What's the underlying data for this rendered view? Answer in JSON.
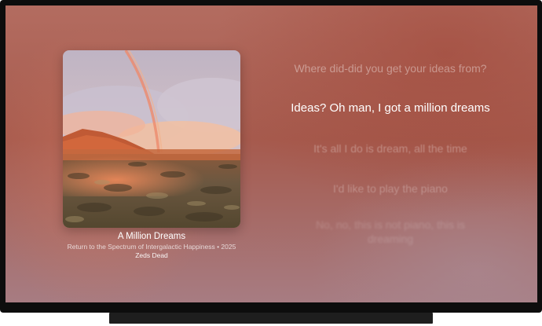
{
  "track": {
    "title": "A Million Dreams",
    "album_line": "Return to the Spectrum of Intergalactic Happiness • 2025",
    "artist": "Zeds Dead"
  },
  "lyrics": [
    "Where did-did you get your ideas from?",
    "Ideas? Oh man, I got a million dreams",
    "It's all I do is dream, all the time",
    "I'd like to play the piano",
    "No, no, this is not piano, this is dreaming"
  ],
  "active_lyric_index": 1
}
